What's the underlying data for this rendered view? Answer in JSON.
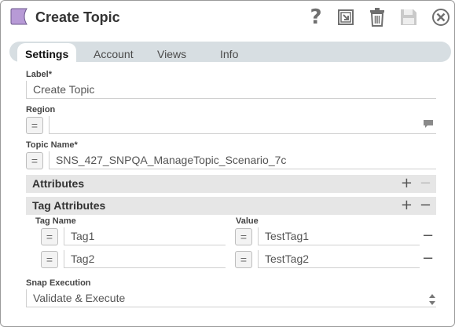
{
  "header": {
    "title": "Create Topic",
    "help_glyph": "?",
    "icons": [
      "snap-icon",
      "help-icon",
      "expand-icon",
      "trash-icon",
      "save-icon",
      "close-icon"
    ],
    "snap_color": "#b79ad6"
  },
  "tabs": [
    {
      "label": "Settings",
      "active": true
    },
    {
      "label": "Account"
    },
    {
      "label": "Views"
    },
    {
      "label": "Info"
    }
  ],
  "fields": {
    "label": {
      "label": "Label*",
      "value": "Create Topic"
    },
    "region": {
      "label": "Region",
      "value": ""
    },
    "topic_name": {
      "label": "Topic Name*",
      "value": "SNS_427_SNPQA_ManageTopic_Scenario_7c"
    }
  },
  "expression_toggle_glyph": "=",
  "sections": {
    "attributes": {
      "title": "Attributes",
      "add": "+",
      "remove": "−"
    },
    "tag_attributes": {
      "title": "Tag Attributes",
      "add": "+",
      "remove": "−",
      "columns": {
        "name": "Tag Name",
        "value": "Value"
      },
      "rows": [
        {
          "name": "Tag1",
          "value": "TestTag1",
          "remove": "−"
        },
        {
          "name": "Tag2",
          "value": "TestTag2",
          "remove": "−"
        }
      ]
    }
  },
  "snap_execution": {
    "label": "Snap Execution",
    "value": "Validate & Execute"
  }
}
